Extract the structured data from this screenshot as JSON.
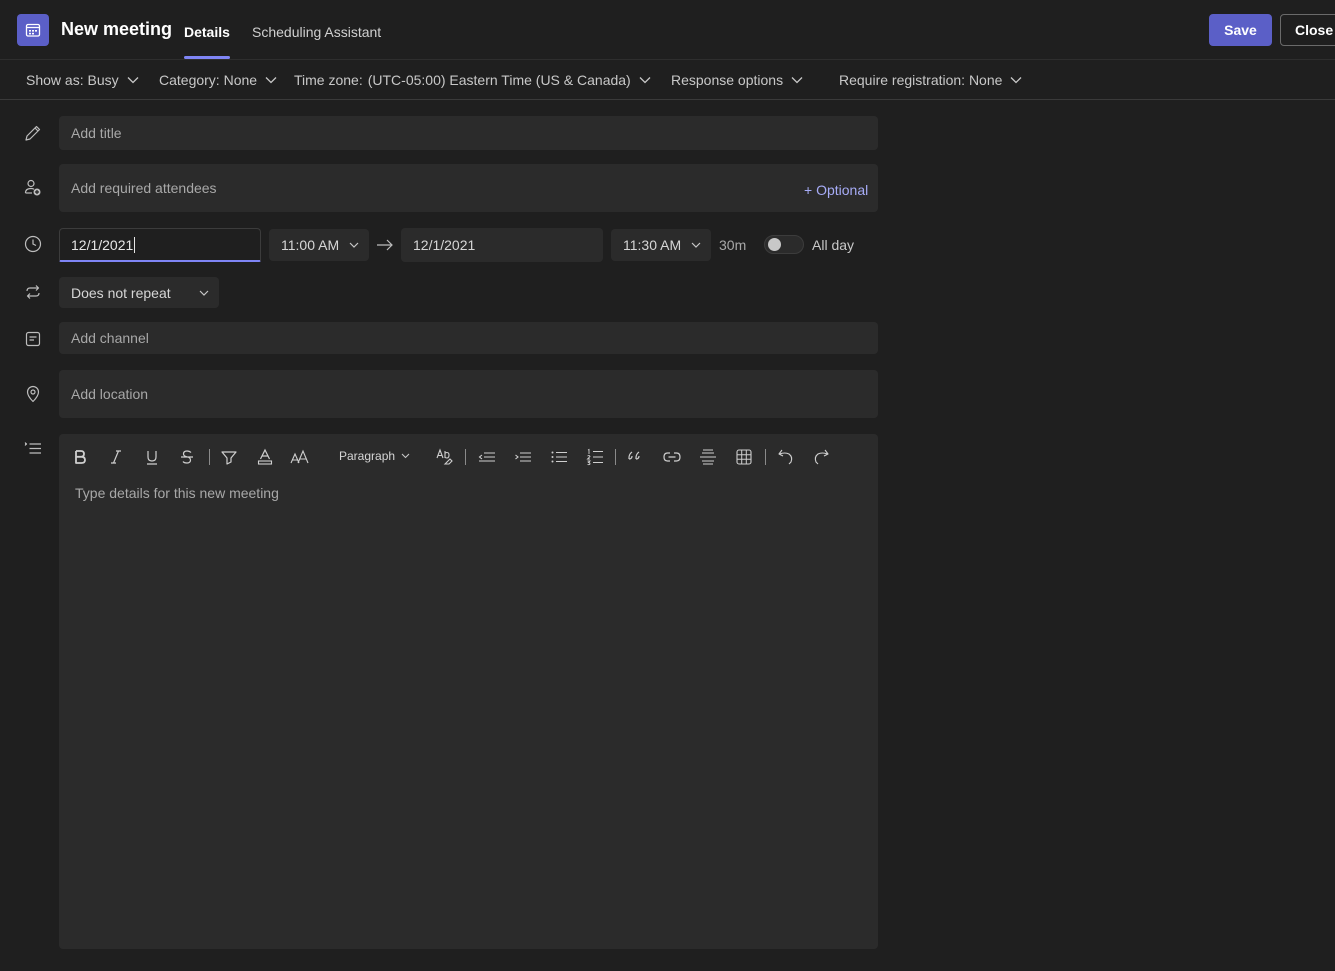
{
  "header": {
    "title": "New meeting",
    "tabs": [
      {
        "label": "Details",
        "active": true
      },
      {
        "label": "Scheduling Assistant",
        "active": false
      }
    ],
    "save_label": "Save",
    "close_label": "Close"
  },
  "options": {
    "show_as": "Show as: Busy",
    "category": "Category: None",
    "timezone_label": "Time zone:",
    "timezone_value": "(UTC-05:00) Eastern Time (US & Canada)",
    "response_options": "Response options",
    "require_registration": "Require registration: None"
  },
  "form": {
    "title_placeholder": "Add title",
    "attendees_placeholder": "Add required attendees",
    "optional_label": "+ Optional",
    "start_date": "12/1/2021",
    "start_time": "11:00 AM",
    "end_date": "12/1/2021",
    "end_time": "11:30 AM",
    "duration": "30m",
    "all_day_label": "All day",
    "all_day_on": false,
    "repeat": "Does not repeat",
    "channel_placeholder": "Add channel",
    "location_placeholder": "Add location"
  },
  "editor": {
    "block_style": "Paragraph",
    "placeholder": "Type details for this new meeting"
  },
  "colors": {
    "accent": "#5b5fc7",
    "accent_light": "#7f85f5",
    "background": "#1f1f1f",
    "field": "#2b2b2b"
  }
}
